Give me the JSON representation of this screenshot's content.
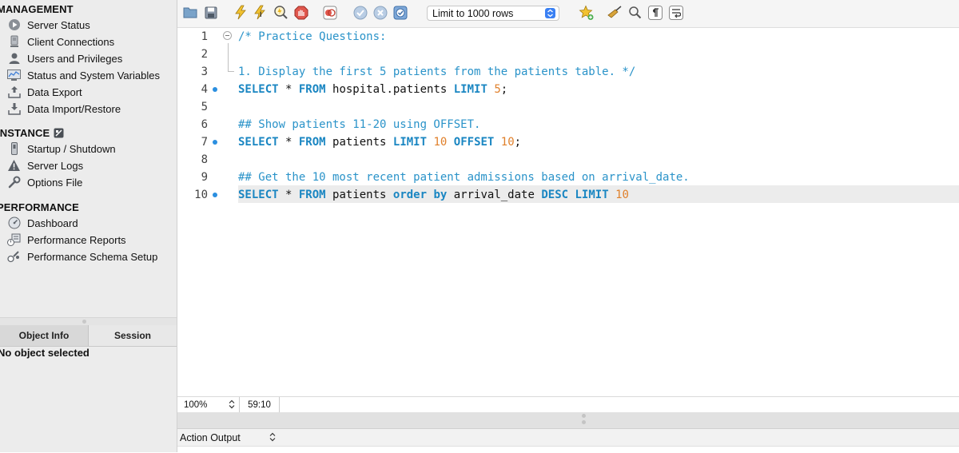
{
  "sidebar": {
    "sections": [
      {
        "title": "MANAGEMENT",
        "items": [
          {
            "label": "Server Status",
            "icon": "play-circle-icon"
          },
          {
            "label": "Client Connections",
            "icon": "computer-icon"
          },
          {
            "label": "Users and Privileges",
            "icon": "user-icon"
          },
          {
            "label": "Status and System Variables",
            "icon": "monitor-chart-icon"
          },
          {
            "label": "Data Export",
            "icon": "export-icon"
          },
          {
            "label": "Data Import/Restore",
            "icon": "import-icon"
          }
        ]
      },
      {
        "title": "INSTANCE",
        "items": [
          {
            "label": "Startup / Shutdown",
            "icon": "power-switch-icon"
          },
          {
            "label": "Server Logs",
            "icon": "warning-icon"
          },
          {
            "label": "Options File",
            "icon": "wrench-icon"
          }
        ]
      },
      {
        "title": "PERFORMANCE",
        "items": [
          {
            "label": "Dashboard",
            "icon": "dashboard-icon"
          },
          {
            "label": "Performance Reports",
            "icon": "reports-icon"
          },
          {
            "label": "Performance Schema Setup",
            "icon": "schema-setup-icon"
          }
        ]
      }
    ],
    "tabs": [
      "Object Info",
      "Session"
    ],
    "no_object_text": "No object selected"
  },
  "toolbar": {
    "limit_select_value": "Limit to 1000 rows"
  },
  "editor": {
    "lines": [
      {
        "num": "1",
        "tokens": [
          {
            "t": "cm",
            "v": "/* Practice Questions:"
          }
        ]
      },
      {
        "num": "2",
        "tokens": []
      },
      {
        "num": "3",
        "tokens": [
          {
            "t": "cm",
            "v": "1. Display the first 5 patients from the patients table. */"
          }
        ]
      },
      {
        "num": "4",
        "marker": true,
        "tokens": [
          {
            "t": "kw",
            "v": "SELECT"
          },
          {
            "t": "id",
            "v": " * "
          },
          {
            "t": "kw",
            "v": "FROM"
          },
          {
            "t": "id",
            "v": " hospital.patients "
          },
          {
            "t": "kw",
            "v": "LIMIT"
          },
          {
            "t": "id",
            "v": " "
          },
          {
            "t": "num",
            "v": "5"
          },
          {
            "t": "id",
            "v": ";"
          }
        ]
      },
      {
        "num": "5",
        "tokens": []
      },
      {
        "num": "6",
        "tokens": [
          {
            "t": "cm",
            "v": "## Show patients 11-20 using OFFSET."
          }
        ]
      },
      {
        "num": "7",
        "marker": true,
        "tokens": [
          {
            "t": "kw",
            "v": "SELECT"
          },
          {
            "t": "id",
            "v": " * "
          },
          {
            "t": "kw",
            "v": "FROM"
          },
          {
            "t": "id",
            "v": " patients "
          },
          {
            "t": "kw",
            "v": "LIMIT"
          },
          {
            "t": "id",
            "v": " "
          },
          {
            "t": "num",
            "v": "10"
          },
          {
            "t": "id",
            "v": " "
          },
          {
            "t": "kw",
            "v": "OFFSET"
          },
          {
            "t": "id",
            "v": " "
          },
          {
            "t": "num",
            "v": "10"
          },
          {
            "t": "id",
            "v": ";"
          }
        ]
      },
      {
        "num": "8",
        "tokens": []
      },
      {
        "num": "9",
        "tokens": [
          {
            "t": "cm",
            "v": "## Get the 10 most recent patient admissions based on arrival_date."
          }
        ]
      },
      {
        "num": "10",
        "marker": true,
        "current": true,
        "tokens": [
          {
            "t": "kw",
            "v": "SELECT"
          },
          {
            "t": "id",
            "v": " * "
          },
          {
            "t": "kw",
            "v": "FROM"
          },
          {
            "t": "id",
            "v": " patients "
          },
          {
            "t": "kw",
            "v": "order by"
          },
          {
            "t": "id",
            "v": " arrival_date "
          },
          {
            "t": "kw",
            "v": "DESC"
          },
          {
            "t": "id",
            "v": " "
          },
          {
            "t": "kw",
            "v": "LIMIT"
          },
          {
            "t": "id",
            "v": " "
          },
          {
            "t": "num",
            "v": "10"
          }
        ]
      }
    ]
  },
  "statusbar": {
    "zoom": "100%",
    "cursor": "59:10"
  },
  "output": {
    "selector_label": "Action Output"
  },
  "colors": {
    "keyword": "#1a86c2",
    "comment": "#2a93c9",
    "number": "#e0802b",
    "marker": "#2b8fe0",
    "current_line": "#ececec"
  }
}
